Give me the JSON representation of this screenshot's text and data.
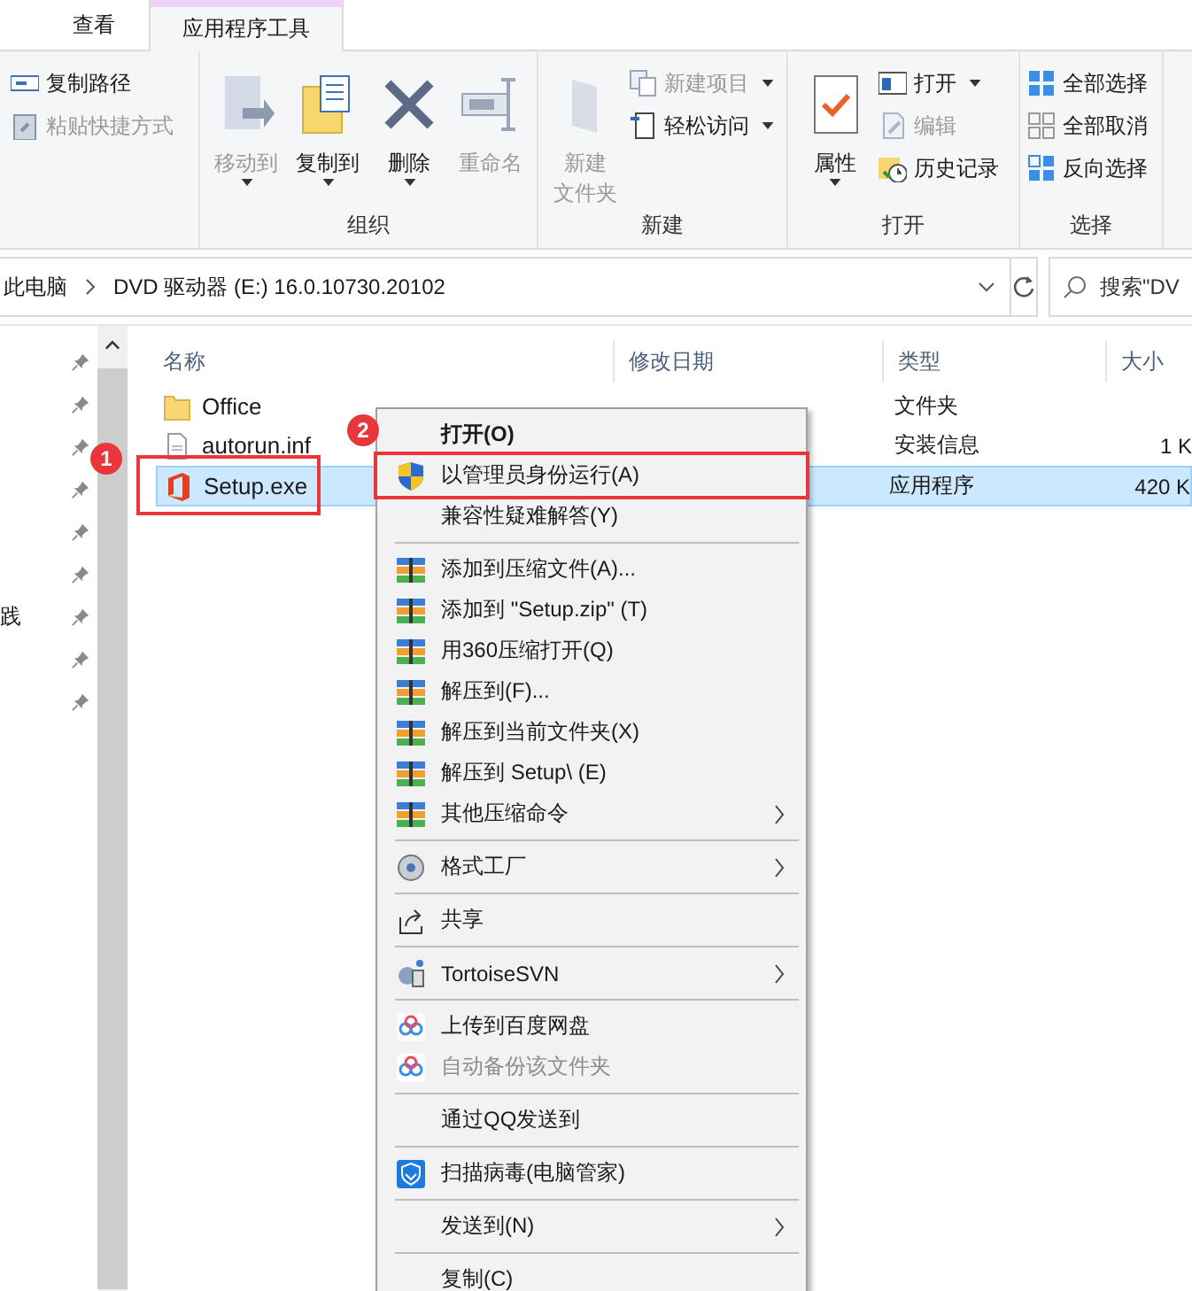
{
  "ribbon": {
    "tabs": [
      {
        "label": "查看",
        "selected": false
      },
      {
        "label": "应用程序工具",
        "selected": true
      }
    ],
    "groups": [
      {
        "items": [
          {
            "kind": "small",
            "label": "复制路径",
            "disabled": false,
            "dropdown": false
          },
          {
            "kind": "small",
            "label": "粘贴快捷方式",
            "disabled": true,
            "dropdown": false
          }
        ]
      },
      {
        "title": "组织",
        "items": [
          {
            "kind": "large",
            "label": "移动到",
            "disabled": true,
            "dropdown": true
          },
          {
            "kind": "large",
            "label": "复制到",
            "disabled": false,
            "dropdown": true
          },
          {
            "kind": "large",
            "label": "删除",
            "disabled": false,
            "dropdown": true
          },
          {
            "kind": "large",
            "label": "重命名",
            "disabled": true,
            "dropdown": false
          }
        ]
      },
      {
        "title": "新建",
        "items": [
          {
            "kind": "large",
            "label": "新建",
            "label_2": "文件夹",
            "disabled": true,
            "dropdown": false
          },
          {
            "kind": "small",
            "label": "新建项目",
            "disabled": true,
            "dropdown": true
          },
          {
            "kind": "small",
            "label": "轻松访问",
            "disabled": false,
            "dropdown": true
          }
        ]
      },
      {
        "title": "打开",
        "items": [
          {
            "kind": "large",
            "label": "属性",
            "disabled": false,
            "dropdown": true
          },
          {
            "kind": "small",
            "label": "打开",
            "disabled": false,
            "dropdown": true
          },
          {
            "kind": "small",
            "label": "编辑",
            "disabled": true,
            "dropdown": false
          },
          {
            "kind": "small",
            "label": "历史记录",
            "disabled": false,
            "dropdown": false
          }
        ]
      },
      {
        "title": "选择",
        "items": [
          {
            "kind": "small",
            "label": "全部选择",
            "disabled": false,
            "dropdown": false
          },
          {
            "kind": "small",
            "label": "全部取消",
            "disabled": false,
            "dropdown": false
          },
          {
            "kind": "small",
            "label": "反向选择",
            "disabled": false,
            "dropdown": false
          }
        ]
      }
    ]
  },
  "address_bar": {
    "crumbs": [
      "此电脑",
      "DVD 驱动器 (E:) 16.0.10730.20102"
    ]
  },
  "search": {
    "placeholder": "搜索\"DV"
  },
  "navigation_pane": {
    "items": [
      {
        "pinned": true
      },
      {
        "pinned": true
      },
      {
        "pinned": true
      },
      {
        "pinned": true
      },
      {
        "pinned": true
      },
      {
        "pinned": true
      },
      {
        "label": "践",
        "pinned": true
      },
      {
        "pinned": true
      },
      {
        "pinned": true
      }
    ]
  },
  "file_list": {
    "columns": [
      "名称",
      "修改日期",
      "类型",
      "大小"
    ],
    "rows": [
      {
        "kind": "folder",
        "name": "Office",
        "type": "文件夹",
        "selected": false
      },
      {
        "kind": "file",
        "name": "autorun.inf",
        "type": "安装信息",
        "size": "1 K",
        "selected": false
      },
      {
        "kind": "app",
        "name": "Setup.exe",
        "type": "应用程序",
        "size": "420 K",
        "selected": true
      }
    ]
  },
  "context_menu": {
    "items": [
      {
        "kind": "plain",
        "label": "打开(O)",
        "default": true,
        "disabled": false,
        "submenu": false
      },
      {
        "kind": "shield",
        "label": "以管理员身份运行(A)",
        "default": false,
        "disabled": false,
        "submenu": false
      },
      {
        "kind": "plain",
        "label": "兼容性疑难解答(Y)",
        "default": false,
        "disabled": false,
        "submenu": false
      },
      {
        "kind": "separator"
      },
      {
        "kind": "archive",
        "label": "添加到压缩文件(A)...",
        "default": false,
        "disabled": false,
        "submenu": false
      },
      {
        "kind": "archive",
        "label": "添加到 \"Setup.zip\" (T)",
        "default": false,
        "disabled": false,
        "submenu": false
      },
      {
        "kind": "archive",
        "label": "用360压缩打开(Q)",
        "default": false,
        "disabled": false,
        "submenu": false
      },
      {
        "kind": "archive",
        "label": "解压到(F)...",
        "default": false,
        "disabled": false,
        "submenu": false
      },
      {
        "kind": "archive",
        "label": "解压到当前文件夹(X)",
        "default": false,
        "disabled": false,
        "submenu": false
      },
      {
        "kind": "archive",
        "label": "解压到 Setup\\ (E)",
        "default": false,
        "disabled": false,
        "submenu": false
      },
      {
        "kind": "archive",
        "label": "其他压缩命令",
        "default": false,
        "disabled": false,
        "submenu": true
      },
      {
        "kind": "separator"
      },
      {
        "kind": "format",
        "label": "格式工厂",
        "default": false,
        "disabled": false,
        "submenu": true
      },
      {
        "kind": "separator"
      },
      {
        "kind": "share",
        "label": "共享",
        "default": false,
        "disabled": false,
        "submenu": false
      },
      {
        "kind": "separator"
      },
      {
        "kind": "svn",
        "label": "TortoiseSVN",
        "default": false,
        "disabled": false,
        "submenu": true
      },
      {
        "kind": "separator"
      },
      {
        "kind": "cloud",
        "label": "上传到百度网盘",
        "default": false,
        "disabled": false,
        "submenu": false
      },
      {
        "kind": "cloud",
        "label": "自动备份该文件夹",
        "default": false,
        "disabled": true,
        "submenu": false
      },
      {
        "kind": "separator"
      },
      {
        "kind": "plain",
        "label": "通过QQ发送到",
        "default": false,
        "disabled": false,
        "submenu": false
      },
      {
        "kind": "separator"
      },
      {
        "kind": "scan",
        "label": "扫描病毒(电脑管家)",
        "default": false,
        "disabled": false,
        "submenu": false
      },
      {
        "kind": "separator"
      },
      {
        "kind": "plain",
        "label": "发送到(N)",
        "default": false,
        "disabled": false,
        "submenu": true
      },
      {
        "kind": "separator"
      },
      {
        "kind": "plain",
        "label": "复制(C)",
        "default": false,
        "disabled": false,
        "submenu": false
      }
    ]
  },
  "annotations": [
    {
      "label": "1"
    },
    {
      "label": "2"
    }
  ]
}
